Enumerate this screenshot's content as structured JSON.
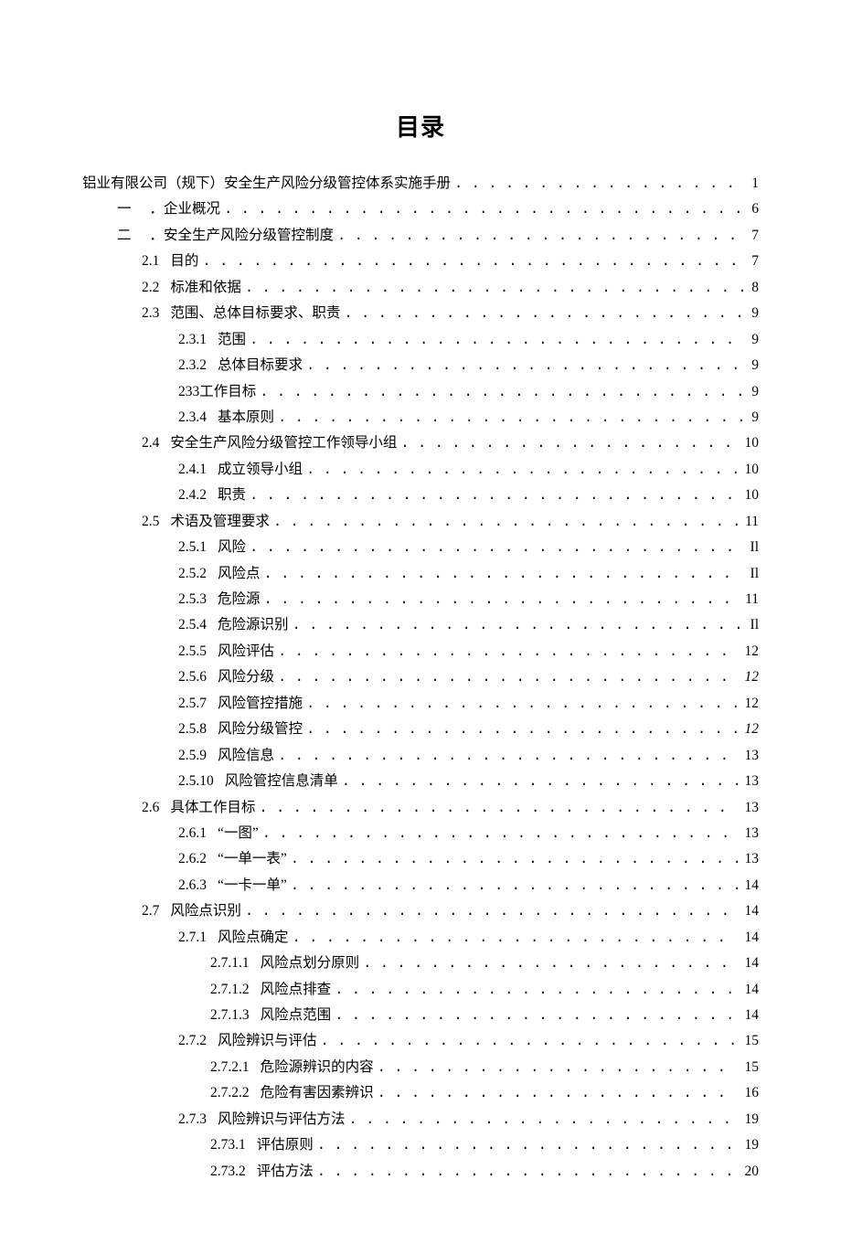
{
  "title": "目录",
  "entries": [
    {
      "indent": "indent1",
      "num": "",
      "text": "铝业有限公司（规下）安全生产风险分级管控体系实施手册",
      "page": "1"
    },
    {
      "indent": "indent2",
      "numcn": "一",
      "text": "．企业概况",
      "page": "6"
    },
    {
      "indent": "indent2",
      "numcn": "二",
      "text": "．安全生产风险分级管控制度",
      "page": "7"
    },
    {
      "indent": "indent3",
      "num": "2.1",
      "text": "目的",
      "page": "7"
    },
    {
      "indent": "indent3",
      "num": "2.2",
      "text": "标准和依据",
      "page": "8"
    },
    {
      "indent": "indent3",
      "num": "2.3",
      "text": "范围、总体目标要求、职责",
      "page": "9"
    },
    {
      "indent": "indent4",
      "num": "2.3.1",
      "text": "范围",
      "page": "9"
    },
    {
      "indent": "indent4",
      "num": "2.3.2",
      "text": "总体目标要求",
      "page": "9"
    },
    {
      "indent": "indent4",
      "num": "",
      "text": "233工作目标",
      "page": "9"
    },
    {
      "indent": "indent4",
      "num": "2.3.4",
      "text": "基本原则",
      "page": "9"
    },
    {
      "indent": "indent3",
      "num": "2.4",
      "text": "安全生产风险分级管控工作领导小组",
      "page": "10"
    },
    {
      "indent": "indent4",
      "num": "2.4.1",
      "text": "成立领导小组",
      "page": "10"
    },
    {
      "indent": "indent4",
      "num": "2.4.2",
      "text": "职责",
      "page": "10"
    },
    {
      "indent": "indent3",
      "num": "2.5",
      "text": "术语及管理要求",
      "page": "11"
    },
    {
      "indent": "indent4",
      "num": "2.5.1",
      "text": "风险",
      "page": "Il"
    },
    {
      "indent": "indent4",
      "num": "2.5.2",
      "text": "风险点",
      "page": "Il"
    },
    {
      "indent": "indent4",
      "num": "2.5.3",
      "text": "危险源",
      "page": "11"
    },
    {
      "indent": "indent4",
      "num": "2.5.4",
      "text": "危险源识别",
      "page": "Il"
    },
    {
      "indent": "indent4",
      "num": "2.5.5",
      "text": "风险评估",
      "page": "12"
    },
    {
      "indent": "indent4",
      "num": "2.5.6",
      "text": "风险分级",
      "page": "12",
      "italic": true
    },
    {
      "indent": "indent4",
      "num": "2.5.7",
      "text": "风险管控措施",
      "page": "12"
    },
    {
      "indent": "indent4",
      "num": "2.5.8",
      "text": "风险分级管控",
      "page": "12",
      "italic": true
    },
    {
      "indent": "indent4",
      "num": "2.5.9",
      "text": "风险信息",
      "page": "13"
    },
    {
      "indent": "indent4",
      "num": "2.5.10",
      "text": "风险管控信息清单",
      "page": "13"
    },
    {
      "indent": "indent3",
      "num": "2.6",
      "text": "具体工作目标",
      "page": "13"
    },
    {
      "indent": "indent4",
      "num": "2.6.1",
      "text": "“一图”",
      "page": "13"
    },
    {
      "indent": "indent4",
      "num": "2.6.2",
      "text": "“一单一表”",
      "page": "13"
    },
    {
      "indent": "indent4",
      "num": "2.6.3",
      "text": "“一卡一单”",
      "page": "14"
    },
    {
      "indent": "indent3",
      "num": "2.7",
      "text": "风险点识别",
      "page": "14"
    },
    {
      "indent": "indent4",
      "num": "2.7.1",
      "text": "风险点确定",
      "page": "14"
    },
    {
      "indent": "indent5",
      "num": "2.7.1.1",
      "text": "风险点划分原则",
      "page": "14"
    },
    {
      "indent": "indent5",
      "num": "2.7.1.2",
      "text": "风险点排查",
      "page": "14"
    },
    {
      "indent": "indent5",
      "num": "2.7.1.3",
      "text": "风险点范围",
      "page": "14"
    },
    {
      "indent": "indent4",
      "num": "2.7.2",
      "text": "风险辨识与评估",
      "page": "15"
    },
    {
      "indent": "indent5",
      "num": "2.7.2.1",
      "text": "危险源辨识的内容",
      "page": "15"
    },
    {
      "indent": "indent5",
      "num": "2.7.2.2",
      "text": "危险有害因素辨识",
      "page": "16"
    },
    {
      "indent": "indent4",
      "num": "2.7.3",
      "text": "风险辨识与评估方法",
      "page": "19"
    },
    {
      "indent": "indent5",
      "num": "2.73.1",
      "text": "评估原则",
      "page": "19"
    },
    {
      "indent": "indent5",
      "num": "2.73.2",
      "text": "评估方法",
      "page": "20"
    }
  ]
}
